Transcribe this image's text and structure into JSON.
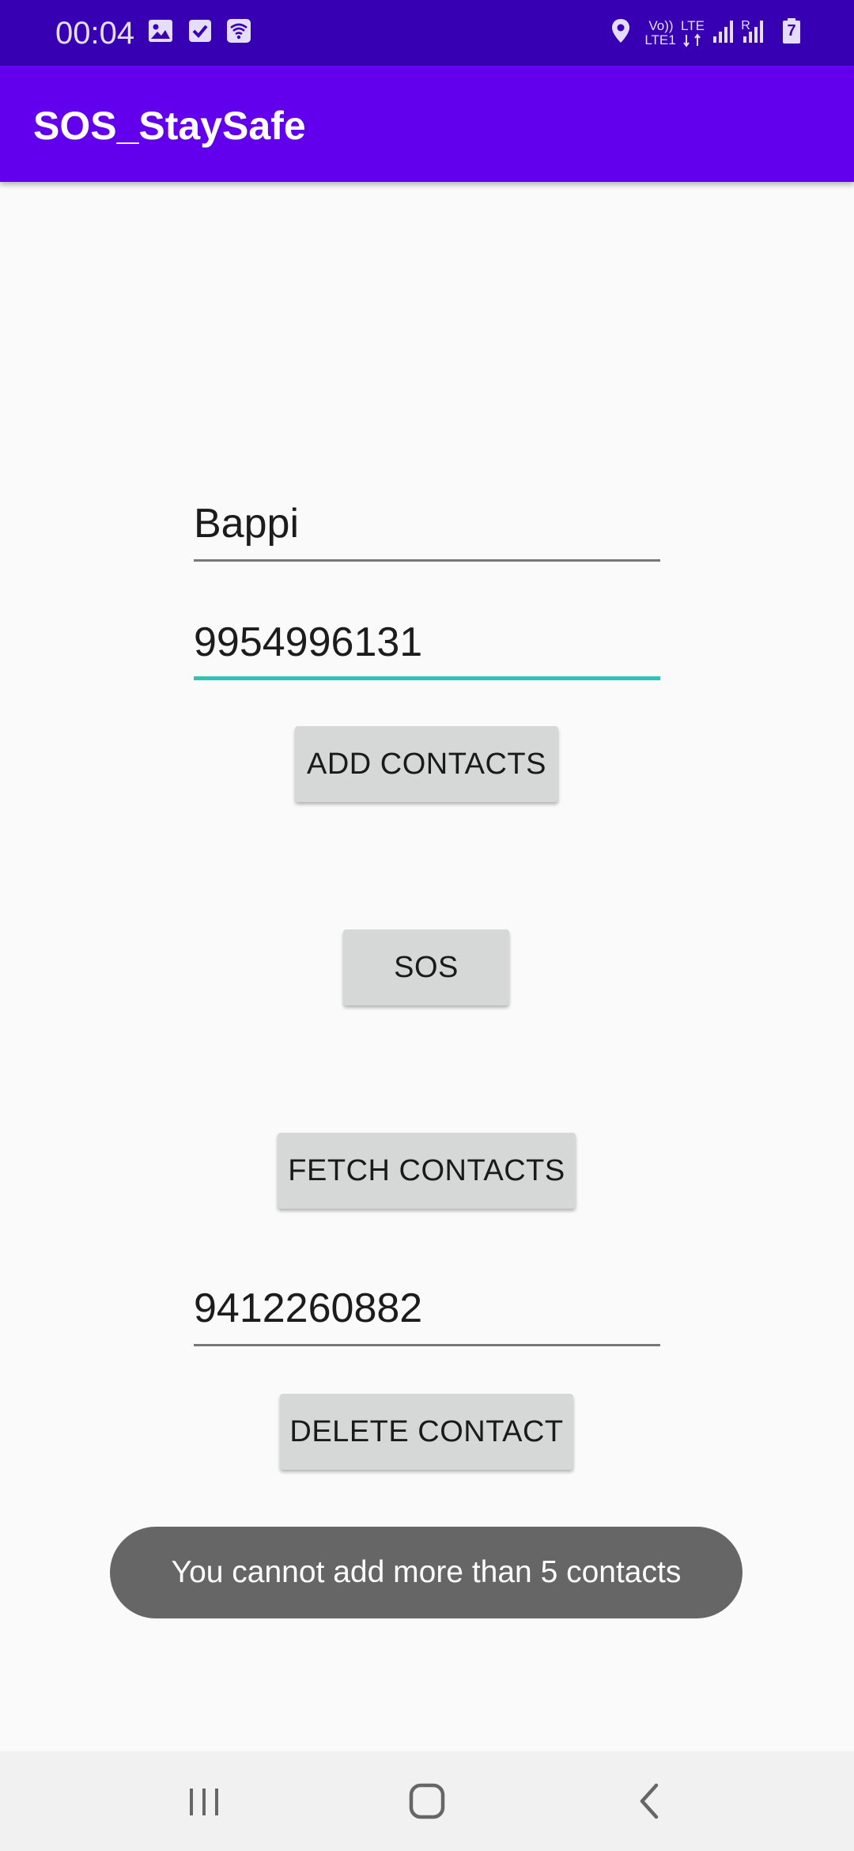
{
  "status_bar": {
    "time": "00:04",
    "volte_label": "Vo))",
    "lte1_label": "LTE1",
    "lte_label": "LTE",
    "roaming_label": "R",
    "battery_level": "7",
    "icons": [
      "image-icon",
      "checkbox-icon",
      "wifi-calling-icon",
      "location-icon",
      "volte-icon",
      "lte-data-icon",
      "signal-icon",
      "roaming-signal-icon",
      "battery-charging-icon"
    ]
  },
  "app_bar": {
    "title": "SOS_StaySafe"
  },
  "form": {
    "name_value": "Bappi",
    "phone_value": "9954996131",
    "add_button": "ADD CONTACTS",
    "sos_button": "SOS",
    "fetch_button": "FETCH CONTACTS",
    "delete_value": "9412260882",
    "delete_button": "DELETE CONTACT"
  },
  "toast": {
    "message": "You cannot add more than 5 contacts"
  },
  "nav_bar": {
    "icons": [
      "recent-apps-icon",
      "home-icon",
      "back-icon"
    ]
  },
  "colors": {
    "status_bar": "#3700b3",
    "app_bar": "#6200ee",
    "accent": "#2ec4b6",
    "background": "#fafafa",
    "button": "#d6d7d7",
    "toast": "#666666"
  }
}
